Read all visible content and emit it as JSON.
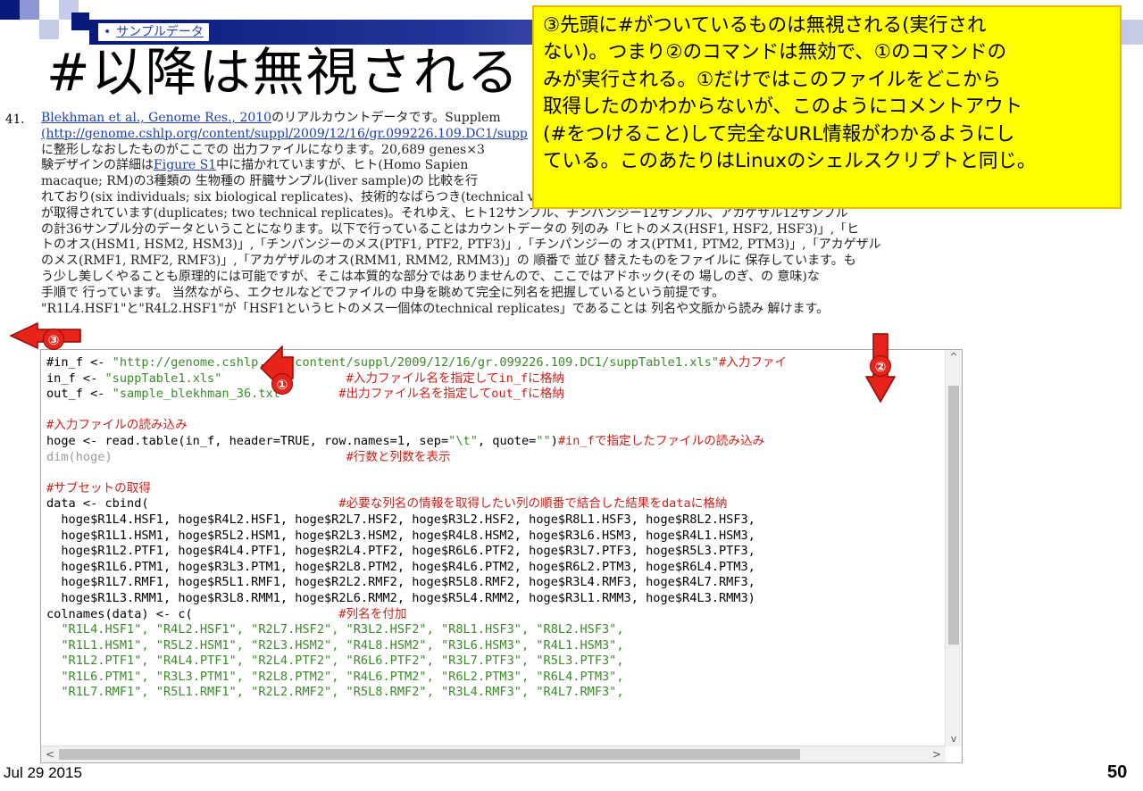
{
  "header": {
    "bullet_link": "サンプルデータ",
    "title": "#以降は無視される"
  },
  "body": {
    "item_number": "41.",
    "lines": [
      {
        "link": "Blekhman et al., Genome Res., 2010",
        "text": "のリアルカウントデータです。Supplem"
      },
      {
        "link": "(http://genome.cshlp.org/content/suppl/2009/12/16/gr.099226.109.DC1/supp",
        "text": ""
      },
      {
        "link": "",
        "text": "に整形しなおしたものがここでの 出力ファイルになります。20,689 genes×3"
      },
      {
        "link": "Figure S1",
        "pre": "験デザインの詳細は",
        "text": "中に描かれていますが、ヒト(Homo Sapien"
      },
      {
        "link": "",
        "text": "macaque; RM)の3種類の 生物種の 肝臓サンプル(liver sample)の 比較を行"
      },
      {
        "link": "",
        "text": "れており(six individuals; six biological replicates)、技術的なばらつき(technical variation)を見積もるべく各個体は2つに分割されてデータ"
      },
      {
        "link": "",
        "text": "が取得されています(duplicates; two technical replicates)。それゆえ、ヒト12サンプル、チンパンジー12サンプル、アカゲザル12サンプル"
      },
      {
        "link": "",
        "text": "の計36サンプル分のデータということになります。以下で行っていることはカウントデータの 列のみ「ヒトのメス(HSF1, HSF2, HSF3)」,「ヒ"
      },
      {
        "link": "",
        "text": "トのオス(HSM1, HSM2, HSM3)」,「チンパンジーのメス(PTF1, PTF2, PTF3)」,「チンパンジーの オス(PTM1, PTM2, PTM3)」,「アカゲザル"
      },
      {
        "link": "",
        "text": "のメス(RMF1, RMF2, RMF3)」,「アカゲザルのオス(RMM1, RMM2, RMM3)」の 順番で 並び 替えたものをファイルに 保存しています。も"
      },
      {
        "link": "",
        "text": "う少し美しくやることも原理的には可能ですが、そこは本質的な部分ではありませんので、ここではアドホック(その 場しのぎ、の 意味)な"
      },
      {
        "link": "",
        "text": "手順で 行っています。 当然ながら、エクセルなどでファイルの 中身を眺めて完全に列名を把握しているという前提です。"
      },
      {
        "link": "",
        "text": "\"R1L4.HSF1\"と\"R4L2.HSF1\"が「HSF1というヒトのメス一個体のtechnical replicates」であることは 列名や文脈から読み 解けます。"
      }
    ]
  },
  "code": {
    "lines": [
      [
        {
          "t": "#in_f <- "
        },
        {
          "t": "\"http://genome.cshlp.org/content/suppl/2009/12/16/gr.099226.109.DC1/suppTable1.xls\"",
          "c": "str"
        },
        {
          "t": "#入力ファイ",
          "c": "cmt"
        }
      ],
      [
        {
          "t": "in_f <- "
        },
        {
          "t": "\"suppTable1.xls\"",
          "c": "str"
        },
        {
          "t": "                 "
        },
        {
          "t": "#入力ファイル名を指定してin_fに格納",
          "c": "cmt"
        }
      ],
      [
        {
          "t": "out_f <- "
        },
        {
          "t": "\"sample_blekhman_36.txt\"",
          "c": "str"
        },
        {
          "t": "       "
        },
        {
          "t": "#出力ファイル名を指定してout_fに格納",
          "c": "cmt"
        }
      ],
      [
        {
          "t": ""
        }
      ],
      [
        {
          "t": "#入力ファイルの読み込み",
          "c": "cmt"
        }
      ],
      [
        {
          "t": "hoge <- read.table(in_f, header=TRUE, row.names=1, sep="
        },
        {
          "t": "\"\\t\"",
          "c": "str"
        },
        {
          "t": ", quote="
        },
        {
          "t": "\"\"",
          "c": "str"
        },
        {
          "t": ")"
        },
        {
          "t": "#in_fで指定したファイルの読み込み",
          "c": "cmt"
        }
      ],
      [
        {
          "t": "dim(hoge)",
          "c": "grey"
        },
        {
          "t": "                                "
        },
        {
          "t": "#行数と列数を表示",
          "c": "cmt"
        }
      ],
      [
        {
          "t": ""
        }
      ],
      [
        {
          "t": "#サブセットの取得",
          "c": "cmt"
        }
      ],
      [
        {
          "t": "data <- cbind(                          "
        },
        {
          "t": "#必要な列名の情報を取得したい列の順番で結合した結果をdataに格納",
          "c": "cmt"
        }
      ],
      [
        {
          "t": "  hoge$R1L4.HSF1, hoge$R4L2.HSF1, hoge$R2L7.HSF2, hoge$R3L2.HSF2, hoge$R8L1.HSF3, hoge$R8L2.HSF3,"
        }
      ],
      [
        {
          "t": "  hoge$R1L1.HSM1, hoge$R5L2.HSM1, hoge$R2L3.HSM2, hoge$R4L8.HSM2, hoge$R3L6.HSM3, hoge$R4L1.HSM3,"
        }
      ],
      [
        {
          "t": "  hoge$R1L2.PTF1, hoge$R4L4.PTF1, hoge$R2L4.PTF2, hoge$R6L6.PTF2, hoge$R3L7.PTF3, hoge$R5L3.PTF3,"
        }
      ],
      [
        {
          "t": "  hoge$R1L6.PTM1, hoge$R3L3.PTM1, hoge$R2L8.PTM2, hoge$R4L6.PTM2, hoge$R6L2.PTM3, hoge$R6L4.PTM3,"
        }
      ],
      [
        {
          "t": "  hoge$R1L7.RMF1, hoge$R5L1.RMF1, hoge$R2L2.RMF2, hoge$R5L8.RMF2, hoge$R3L4.RMF3, hoge$R4L7.RMF3,"
        }
      ],
      [
        {
          "t": "  hoge$R1L3.RMM1, hoge$R3L8.RMM1, hoge$R2L6.RMM2, hoge$R5L4.RMM2, hoge$R3L1.RMM3, hoge$R4L3.RMM3)"
        }
      ],
      [
        {
          "t": "colnames(data) <- c(                    "
        },
        {
          "t": "#列名を付加",
          "c": "cmt"
        }
      ],
      [
        {
          "t": "  "
        },
        {
          "t": "\"R1L4.HSF1\", \"R4L2.HSF1\", \"R2L7.HSF2\", \"R3L2.HSF2\", \"R8L1.HSF3\", \"R8L2.HSF3\",",
          "c": "str"
        }
      ],
      [
        {
          "t": "  "
        },
        {
          "t": "\"R1L1.HSM1\", \"R5L2.HSM1\", \"R2L3.HSM2\", \"R4L8.HSM2\", \"R3L6.HSM3\", \"R4L1.HSM3\",",
          "c": "str"
        }
      ],
      [
        {
          "t": "  "
        },
        {
          "t": "\"R1L2.PTF1\", \"R4L4.PTF1\", \"R2L4.PTF2\", \"R6L6.PTF2\", \"R3L7.PTF3\", \"R5L3.PTF3\",",
          "c": "str"
        }
      ],
      [
        {
          "t": "  "
        },
        {
          "t": "\"R1L6.PTM1\", \"R3L3.PTM1\", \"R2L8.PTM2\", \"R4L6.PTM2\", \"R6L2.PTM3\", \"R6L4.PTM3\",",
          "c": "str"
        }
      ],
      [
        {
          "t": "  "
        },
        {
          "t": "\"R1L7.RMF1\", \"R5L1.RMF1\", \"R2L2.RMF2\", \"R5L8.RMF2\", \"R3L4.RMF3\", \"R4L7.RMF3\",",
          "c": "str"
        }
      ]
    ]
  },
  "callout": {
    "lines": [
      "③先頭に#がついているものは無視される(実行され",
      "ない)。つまり②のコマンドは無効で、①のコマンドの",
      "みが実行される。①だけではこのファイルをどこから",
      "取得したのかわからないが、このようにコメントアウト",
      "(#をつけること)して完全なURL情報がわかるようにし",
      "ている。このあたりはLinuxのシェルスクリプトと同じ。"
    ]
  },
  "markers": {
    "m1": "①",
    "m2": "②",
    "m3": "③"
  },
  "footer": {
    "date": "Jul 29 2015",
    "page": "50"
  },
  "colors": {
    "marker_red": "#e8231a",
    "callout_yellow": "#ffff00",
    "string_green": "#3a8a2a",
    "comment_red": "#d0201a",
    "band_navy": "#0a1a7a"
  }
}
